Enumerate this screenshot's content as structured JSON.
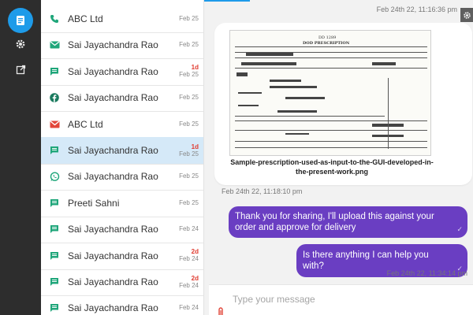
{
  "nav": {
    "items": [
      {
        "name": "conversations",
        "icon": "chat-list-icon",
        "active": true
      },
      {
        "name": "settings",
        "icon": "gear-icon"
      },
      {
        "name": "external",
        "icon": "external-link-icon"
      }
    ]
  },
  "conversations": [
    {
      "channel": "phone-icon",
      "name": "ABC Ltd",
      "age": "",
      "date": "Feb 25"
    },
    {
      "channel": "email-icon",
      "name": "Sai Jayachandra Rao",
      "age": "",
      "date": "Feb 25"
    },
    {
      "channel": "sms-icon",
      "name": "Sai Jayachandra Rao",
      "age": "1d",
      "date": "Feb 25"
    },
    {
      "channel": "facebook-icon",
      "name": "Sai Jayachandra Rao",
      "age": "",
      "date": "Feb 25"
    },
    {
      "channel": "gmail-icon",
      "name": "ABC Ltd",
      "age": "",
      "date": "Feb 25"
    },
    {
      "channel": "sms-icon",
      "name": "Sai Jayachandra Rao",
      "age": "1d",
      "date": "Feb 25",
      "selected": true
    },
    {
      "channel": "whatsapp-icon",
      "name": "Sai Jayachandra Rao",
      "age": "",
      "date": "Feb 25"
    },
    {
      "channel": "sms-icon",
      "name": "Preeti Sahni",
      "age": "",
      "date": "Feb 25"
    },
    {
      "channel": "sms-icon",
      "name": "Sai Jayachandra Rao",
      "age": "",
      "date": "Feb 24"
    },
    {
      "channel": "sms-icon",
      "name": "Sai Jayachandra Rao",
      "age": "2d",
      "date": "Feb 24"
    },
    {
      "channel": "sms-icon",
      "name": "Sai Jayachandra Rao",
      "age": "2d",
      "date": "Feb 24"
    },
    {
      "channel": "sms-icon",
      "name": "Sai Jayachandra Rao",
      "age": "",
      "date": "Feb 24"
    }
  ],
  "chat": {
    "top_timestamp": "Feb 24th 22, 11:16:36 pm",
    "attachment": {
      "filename": "Sample-prescription-used-as-input-to-the-GUI-developed-in-the-present-work.png",
      "timestamp": "Feb 24th 22, 11:18:10 pm",
      "doc_header": "DOD PRESCRIPTION"
    },
    "messages": [
      {
        "text": "Thank you for sharing, I'll upload this against your order and approve for delivery",
        "status": "✓"
      },
      {
        "text": "Is there anything I can help you with?",
        "status": "✓"
      }
    ],
    "last_timestamp": "Feb 24th 22, 11:34:14 pm",
    "composer": {
      "placeholder": "Type your message"
    }
  },
  "colors": {
    "accent": "#1e9be9",
    "bubble": "#6a3ec2",
    "rail": "#2d2d2d",
    "selected_row": "#d5e9f8",
    "channel_green": "#1fa67a",
    "gmail_red": "#e2463a",
    "facebook": "#1a7a5e"
  }
}
